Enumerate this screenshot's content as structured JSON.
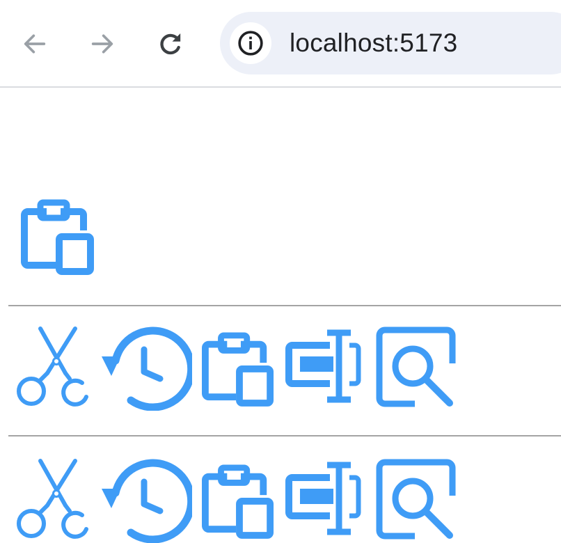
{
  "browser": {
    "address": "localhost:5173",
    "nav": {
      "back_icon": "arrow-left-icon",
      "forward_icon": "arrow-right-icon",
      "reload_icon": "reload-icon",
      "site_info_icon": "info-circle-icon"
    }
  },
  "content": {
    "accent_color": "#3f9cf6",
    "featured_icon": "paste-icon",
    "icon_rows": [
      [
        "scissors-icon",
        "history-icon",
        "paste-icon",
        "rename-icon",
        "search-preview-icon"
      ],
      [
        "scissors-icon",
        "history-icon",
        "paste-icon",
        "rename-icon",
        "search-preview-icon"
      ]
    ]
  }
}
